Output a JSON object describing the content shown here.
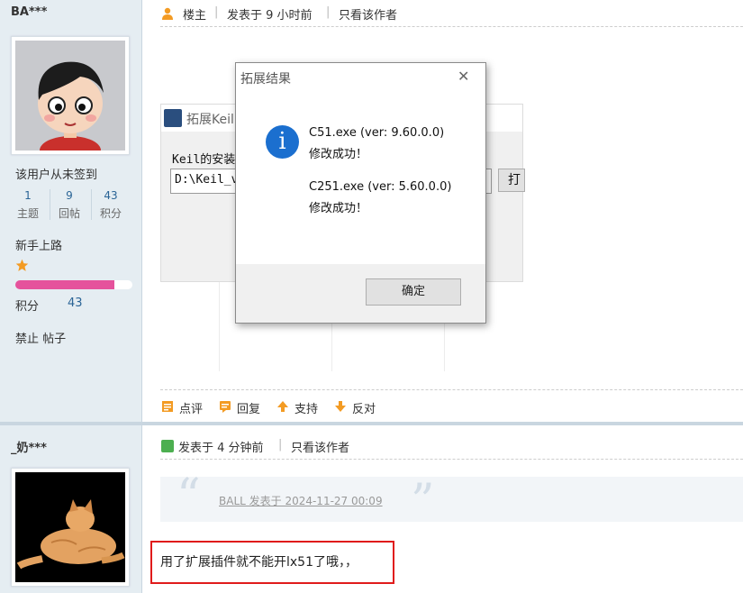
{
  "post1": {
    "username": "BA***",
    "signin_text": "该用户从未签到",
    "stats": [
      {
        "value": "1",
        "label": "主题"
      },
      {
        "value": "9",
        "label": "回帖"
      },
      {
        "value": "43",
        "label": "积分"
      }
    ],
    "rank": "新手上路",
    "points_label": "积分",
    "points_value": "43",
    "ban_text": "禁止 帖子",
    "meta": {
      "floor": "楼主",
      "posted": "发表于 9 小时前",
      "only_author": "只看该作者"
    },
    "actions": {
      "comment": "点评",
      "reply": "回复",
      "support": "支持",
      "oppose": "反对"
    },
    "screenshot": {
      "bg_window_title": "拓展Keil",
      "bg_label": "Keil的安装",
      "bg_path": "D:\\Keil_v",
      "bg_button": "打",
      "dialog_title": "拓展结果",
      "line1": "C51.exe (ver: 9.60.0.0)",
      "line2": "修改成功！",
      "line3": "C251.exe (ver: 5.60.0.0)",
      "line4": "修改成功！",
      "ok": "确定",
      "close": "✕",
      "info_glyph": "i"
    }
  },
  "post2": {
    "username": "_奶***",
    "meta": {
      "posted": "发表于 4 分钟前",
      "only_author": "只看该作者"
    },
    "quote": "BALL 发表于 2024-11-27 00:09",
    "quote_open": "“",
    "quote_close": "”",
    "message": "用了扩展插件就不能开lx51了哦，，"
  },
  "colors": {
    "accent_orange": "#f39b23",
    "link_blue": "#2a6496",
    "red_box": "#e01b1b",
    "progress_pink": "#e5529c"
  },
  "icons": [
    "user-icon",
    "star-icon",
    "comment-icon",
    "reply-icon",
    "support-arrow-icon",
    "oppose-arrow-icon",
    "info-icon",
    "close-icon",
    "quote-icon"
  ]
}
